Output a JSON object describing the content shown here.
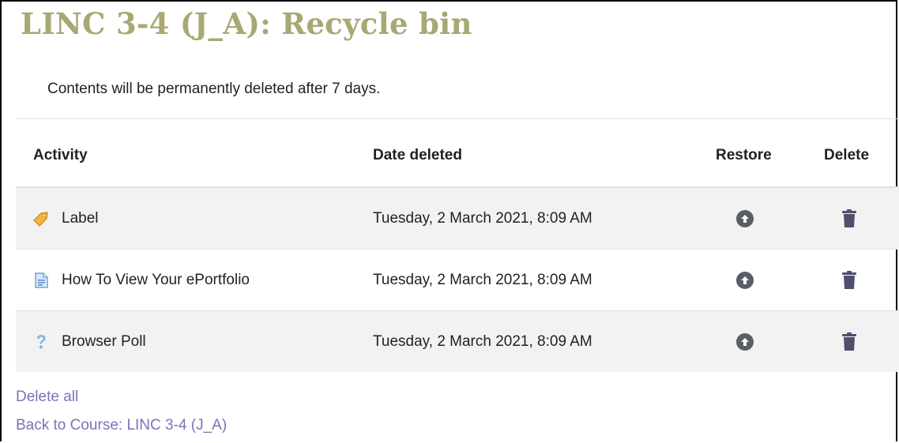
{
  "page": {
    "title": "LINC 3-4 (J_A): Recycle bin",
    "notice": "Contents will be permanently deleted after 7 days."
  },
  "table": {
    "headers": {
      "activity": "Activity",
      "date_deleted": "Date deleted",
      "restore": "Restore",
      "delete": "Delete"
    },
    "rows": [
      {
        "activity": "Label",
        "icon": "label-tag-icon",
        "date_deleted": "Tuesday, 2 March 2021, 8:09 AM"
      },
      {
        "activity": "How To View Your ePortfolio",
        "icon": "page-document-icon",
        "date_deleted": "Tuesday, 2 March 2021, 8:09 AM"
      },
      {
        "activity": "Browser Poll",
        "icon": "question-mark-icon",
        "date_deleted": "Tuesday, 2 March 2021, 8:09 AM"
      }
    ]
  },
  "links": {
    "delete_all": "Delete all",
    "back_to_course": "Back to Course: LINC 3-4 (J_A)"
  },
  "colors": {
    "title": "#a8a874",
    "link": "#7873b8",
    "row_alt": "#f2f2f2",
    "action_icon": "#5a5d66"
  }
}
